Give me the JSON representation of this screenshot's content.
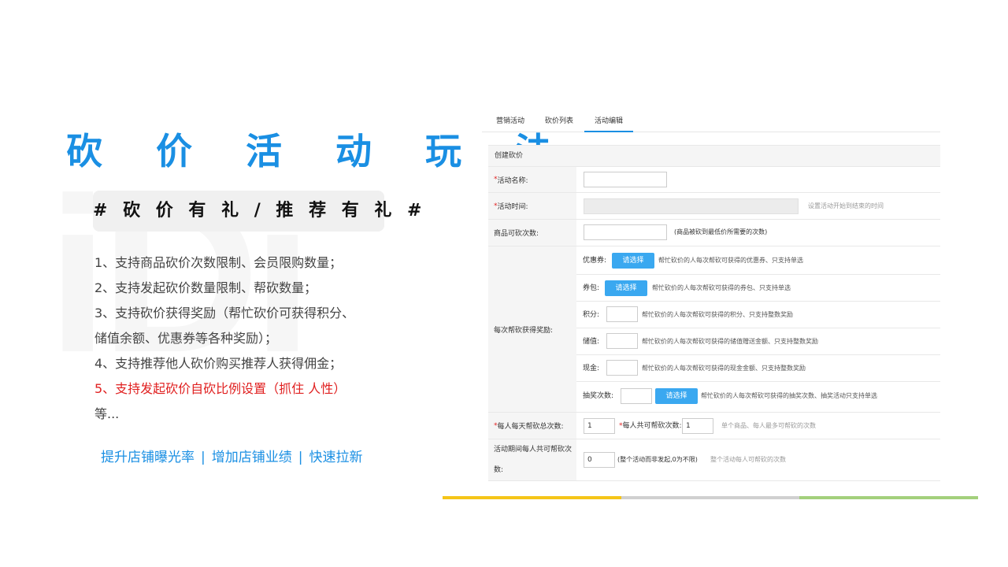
{
  "left": {
    "title": "砍 价 活 动 玩 法",
    "hashtag": "# 砍 价 有 礼 / 推 荐 有 礼 #",
    "features": [
      "1、支持商品砍价次数限制、会员限购数量；",
      "2、支持发起砍价数量限制、帮砍数量；",
      "3、支持砍价获得奖励（帮忙砍价可获得积分、",
      "储值余额、优惠券等各种奖励）；",
      "4、支持推荐他人砍价购买推荐人获得佣金；",
      "5、支持发起砍价自砍比例设置（抓住  人性）",
      "等..."
    ],
    "slogan": {
      "item1": "提升店铺曝光率",
      "item2": "增加店铺业绩",
      "item3": "快速拉新",
      "separator": "|"
    }
  },
  "admin": {
    "tabs": [
      "营销活动",
      "砍价列表",
      "活动编辑"
    ],
    "form_title": "创建砍价",
    "fields": {
      "name_label": "活动名称:",
      "time_label": "活动时间:",
      "time_hint": "设置活动开始到结束的时间",
      "count_label": "商品可砍次数:",
      "count_hint": "(商品被砍到最低价所需要的次数)",
      "reward_label": "每次帮砍获得奖励:",
      "daily_label": "每人每天帮砍总次数:",
      "daily_value": "1",
      "total_label": "每人共可帮砍次数:",
      "total_value": "1",
      "total_hint": "单个商品、每人最多可帮砍的次数",
      "period_label_1": "活动期间每人共可帮砍次",
      "period_label_2": "数:",
      "period_value": "0",
      "period_note": "(整个活动而非发起,0为不限)",
      "period_hint": "整个活动每人可帮砍的次数",
      "required_mark": "*"
    },
    "rewards": {
      "coupon_label": "优惠券:",
      "coupon_button": "请选择",
      "coupon_hint": "帮忙砍价的人每次帮砍可获得的优惠券、只支持单选",
      "package_label": "券包:",
      "package_button": "请选择",
      "package_hint": "帮忙砍价的人每次帮砍可获得的券包、只支持单选",
      "points_label": "积分:",
      "points_hint": "帮忙砍价的人每次帮砍可获得的积分、只支持整数奖励",
      "balance_label": "储值:",
      "balance_hint": "帮忙砍价的人每次帮砍可获得的储值赠送金额、只支持整数奖励",
      "cash_label": "现金:",
      "cash_hint": "帮忙砍价的人每次帮砍可获得的现金金额、只支持整数奖励",
      "lottery_label": "抽奖次数:",
      "lottery_button": "请选择",
      "lottery_hint": "帮忙砍价的人每次帮砍可获得的抽奖次数、抽奖活动只支持单选"
    }
  },
  "colors": {
    "accent_blue": "#1a8fe3",
    "highlight_red": "#e02020",
    "bar_yellow": "#f5c518",
    "bar_gray": "#d0d0d0",
    "bar_green": "#a3d07c"
  }
}
